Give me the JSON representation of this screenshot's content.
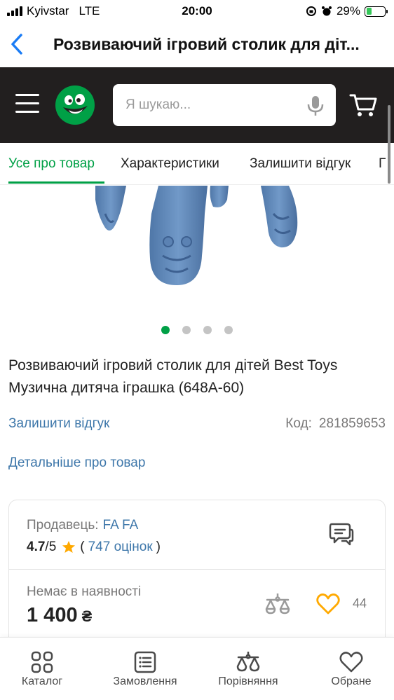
{
  "status_bar": {
    "carrier": "Kyivstar",
    "network": "LTE",
    "time": "20:00",
    "battery": "29%",
    "battery_level": 0.29
  },
  "browser": {
    "title": "Розвиваючий ігровий столик для діт..."
  },
  "header": {
    "search_placeholder": "Я шукаю..."
  },
  "tabs": [
    {
      "label": "Усе про товар",
      "active": true
    },
    {
      "label": "Характеристики",
      "active": false
    },
    {
      "label": "Залишити відгук",
      "active": false
    },
    {
      "label": "Г",
      "active": false
    }
  ],
  "gallery": {
    "slides": 4,
    "active_slide": 1
  },
  "product": {
    "name": "Розвиваючий ігровий столик для дітей Best Toys Музична дитяча іграшка (648А-60)",
    "review_link": "Залишити відгук",
    "code_label": "Код:",
    "code": "281859653",
    "details_link": "Детальніше про товар"
  },
  "seller": {
    "label": "Продавець:",
    "name": "FA FA",
    "rating": "4.7",
    "rating_max": "/5",
    "open_paren": "(",
    "reviews": "747 оцінок",
    "close_paren": ")"
  },
  "offer": {
    "availability": "Немає в наявності",
    "price": "1 400",
    "currency": "₴",
    "favorites_count": "44"
  },
  "bottom_nav": [
    {
      "label": "Каталог",
      "icon": "catalog-icon"
    },
    {
      "label": "Замовлення",
      "icon": "orders-icon"
    },
    {
      "label": "Порівняння",
      "icon": "compare-icon"
    },
    {
      "label": "Обране",
      "icon": "heart-icon"
    }
  ],
  "colors": {
    "accent_green": "#00a046",
    "link_blue": "#3e77aa",
    "header_dark": "#221f1f",
    "star": "#ffa900"
  }
}
